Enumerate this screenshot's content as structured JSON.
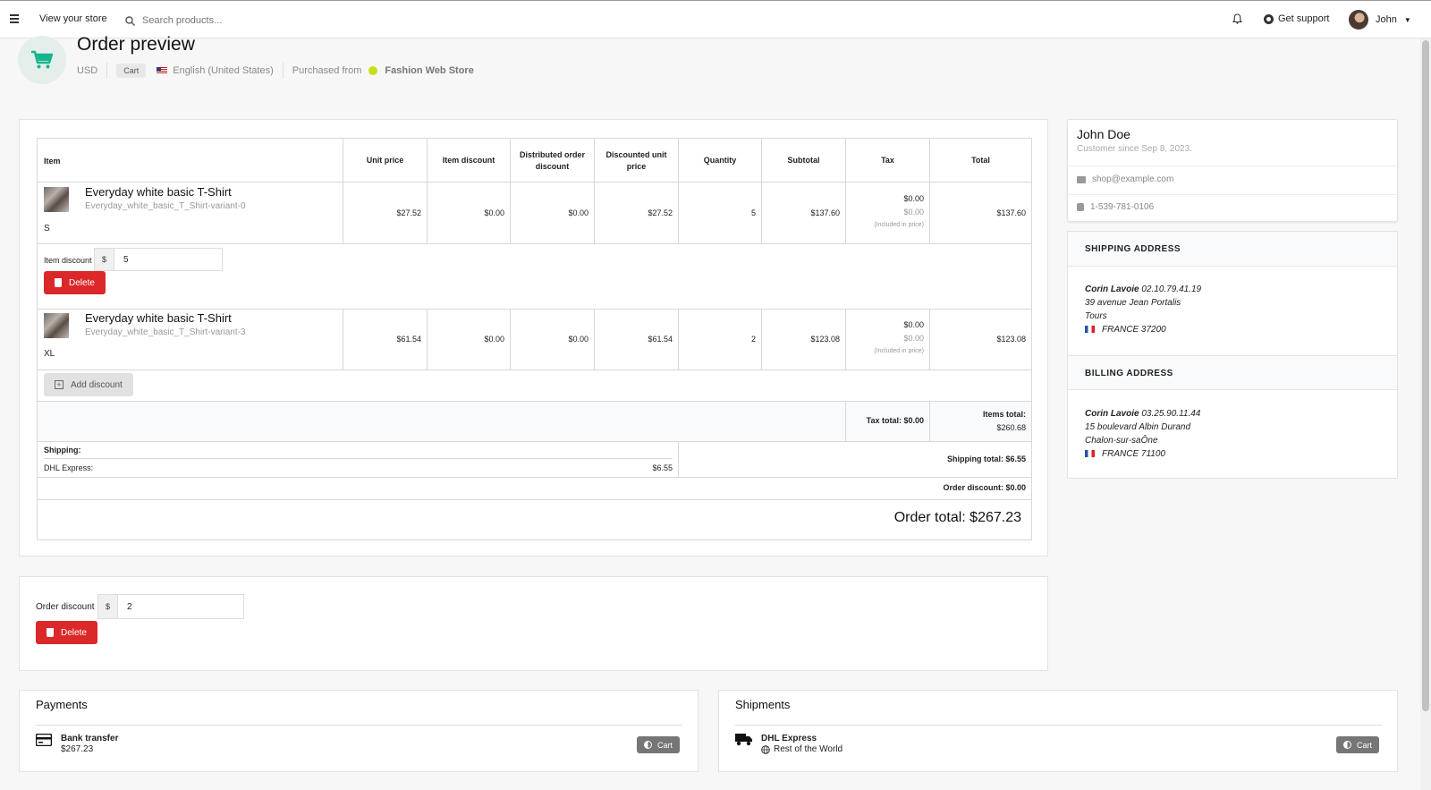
{
  "topbar": {
    "store_link": "View your store",
    "search_placeholder": "Search products...",
    "support": "Get support",
    "user": "John"
  },
  "header": {
    "title": "Order preview",
    "currency": "USD",
    "state": "Cart",
    "locale": "English (United States)",
    "purchased_from": "Purchased from",
    "channel": "Fashion Web Store"
  },
  "table": {
    "headers": [
      "Item",
      "Unit price",
      "Item discount",
      "Distributed order discount",
      "Discounted unit price",
      "Quantity",
      "Subtotal",
      "Tax",
      "Total"
    ],
    "items": [
      {
        "name": "Everyday white basic T-Shirt",
        "variant": "Everyday_white_basic_T_Shirt-variant-0",
        "size": "S",
        "unit_price": "$27.52",
        "item_discount": "$0.00",
        "distributed_discount": "$0.00",
        "discounted_unit_price": "$27.52",
        "quantity": "5",
        "subtotal": "$137.60",
        "tax": "$0.00",
        "tax_included": "$0.00",
        "tax_note": "(Included in price)",
        "total": "$137.60"
      },
      {
        "name": "Everyday white basic T-Shirt",
        "variant": "Everyday_white_basic_T_Shirt-variant-3",
        "size": "XL",
        "unit_price": "$61.54",
        "item_discount": "$0.00",
        "distributed_discount": "$0.00",
        "discounted_unit_price": "$61.54",
        "quantity": "2",
        "subtotal": "$123.08",
        "tax": "$0.00",
        "tax_included": "$0.00",
        "tax_note": "(Included in price)",
        "total": "$123.08"
      }
    ],
    "item_discount_label": "Item discount",
    "currency_symbol": "$",
    "item_discount_value": "5",
    "delete_label": "Delete",
    "add_discount_label": "Add discount",
    "tax_total": "Tax total: $0.00",
    "items_total_label": "Items total:",
    "items_total_value": "$260.68",
    "shipping_label": "Shipping:",
    "shipping_method": "DHL Express:",
    "shipping_cost": "$6.55",
    "shipping_total": "Shipping total: $6.55",
    "order_discount": "Order discount: $0.00",
    "order_total": "Order total: $267.23"
  },
  "order_discount_form": {
    "label": "Order discount",
    "currency_symbol": "$",
    "value": "2",
    "delete_label": "Delete"
  },
  "customer": {
    "name": "John Doe",
    "since": "Customer since Sep 8, 2023.",
    "email": "shop@example.com",
    "phone": "1-539-781-0106"
  },
  "shipping_address": {
    "title": "SHIPPING ADDRESS",
    "name": "Corin Lavoie",
    "phone": "02.10.79.41.19",
    "street": "39 avenue Jean Portalis",
    "city": "Tours",
    "country_postcode": "FRANCE 37200"
  },
  "billing_address": {
    "title": "BILLING ADDRESS",
    "name": "Corin Lavoie",
    "phone": "03.25.90.11.44",
    "street": "15 boulevard Albin Durand",
    "city": "Chalon-sur-saÔne",
    "country_postcode": "FRANCE 71100"
  },
  "payments": {
    "title": "Payments",
    "method": "Bank transfer",
    "amount": "$267.23",
    "state": "Cart"
  },
  "shipments": {
    "title": "Shipments",
    "method": "DHL Express",
    "zone": "Rest of the World",
    "state": "Cart"
  },
  "colors": {
    "accent": "#21ba45",
    "danger": "#db2828",
    "chip": "#767676"
  }
}
